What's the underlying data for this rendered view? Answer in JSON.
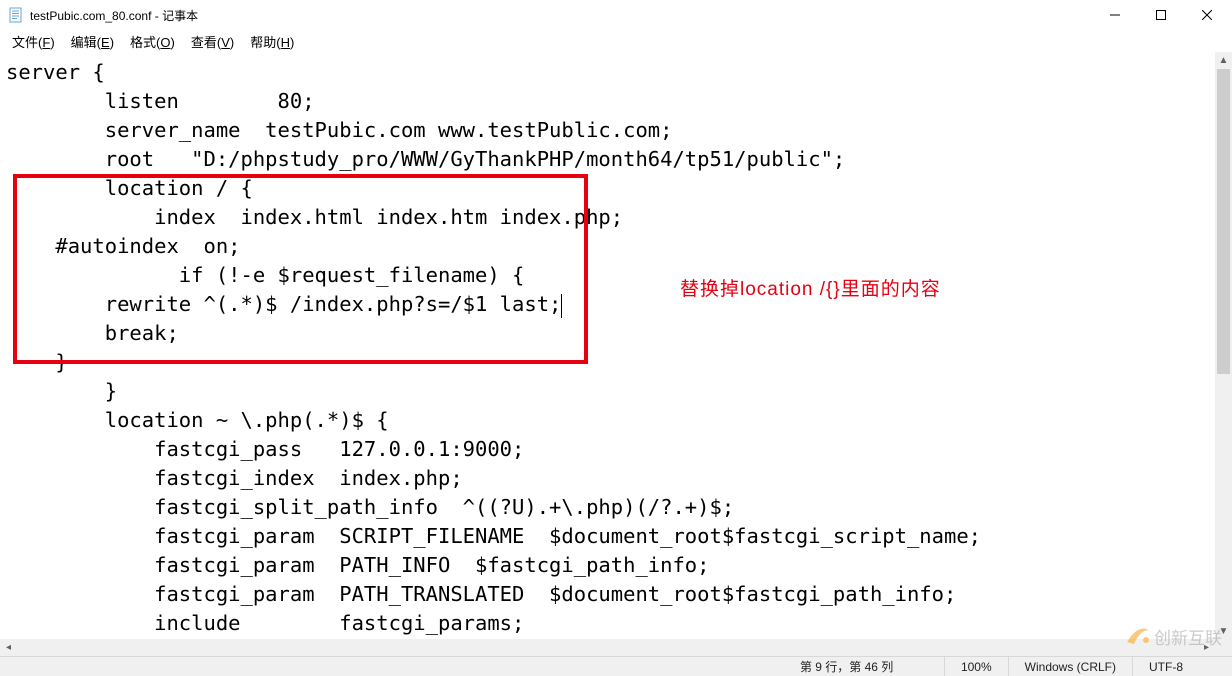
{
  "window": {
    "title": "testPubic.com_80.conf - 记事本",
    "icon": "notepad-icon"
  },
  "menu": {
    "file": {
      "label": "文件",
      "hotkey": "F"
    },
    "edit": {
      "label": "编辑",
      "hotkey": "E"
    },
    "format": {
      "label": "格式",
      "hotkey": "O"
    },
    "view": {
      "label": "查看",
      "hotkey": "V"
    },
    "help": {
      "label": "帮助",
      "hotkey": "H"
    }
  },
  "editor": {
    "lines": [
      "server {",
      "        listen        80;",
      "        server_name  testPubic.com www.testPublic.com;",
      "        root   \"D:/phpstudy_pro/WWW/GyThankPHP/month64/tp51/public\";",
      "        location / {",
      "            index  index.html index.htm index.php;",
      "    #autoindex  on;",
      "              if (!-e $request_filename) {",
      "        rewrite ^(.*)$ /index.php?s=/$1 last;",
      "        break;",
      "    }",
      "        }",
      "        location ~ \\.php(.*)$ {",
      "            fastcgi_pass   127.0.0.1:9000;",
      "            fastcgi_index  index.php;",
      "            fastcgi_split_path_info  ^((?U).+\\.php)(/?.+)$;",
      "            fastcgi_param  SCRIPT_FILENAME  $document_root$fastcgi_script_name;",
      "            fastcgi_param  PATH_INFO  $fastcgi_path_info;",
      "            fastcgi_param  PATH_TRANSLATED  $document_root$fastcgi_path_info;",
      "            include        fastcgi_params;",
      "        }"
    ],
    "cursor_line_index": 8
  },
  "annotation": {
    "text": "替换掉location /{}里面的内容",
    "color": "#e60012"
  },
  "status": {
    "position": "第 9 行，第 46 列",
    "zoom": "100%",
    "line_ending": "Windows (CRLF)",
    "encoding": "UTF-8"
  },
  "watermark": {
    "text": "创新互联",
    "icon": "swoosh-icon"
  }
}
